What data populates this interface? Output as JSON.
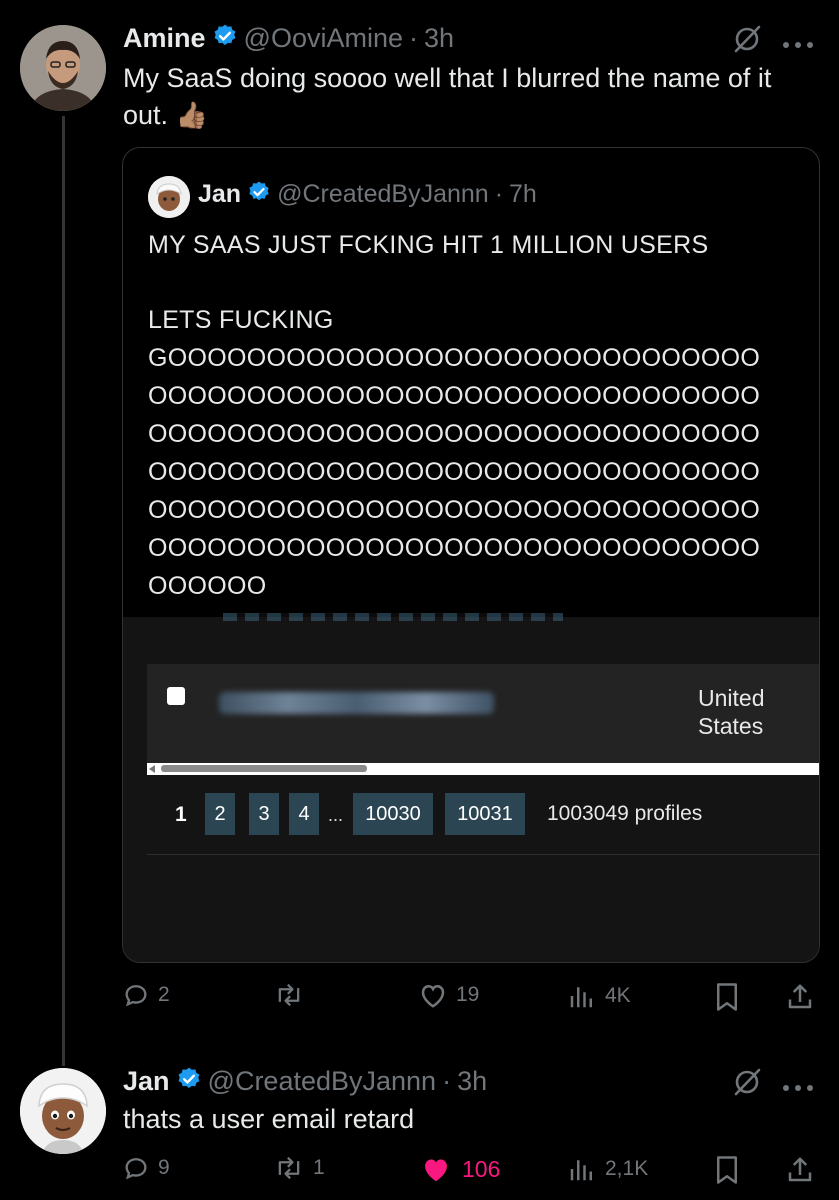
{
  "tweet": {
    "author_name": "Amine",
    "author_handle": "@OoviAmine",
    "separator": "·",
    "time": "3h",
    "text": "My SaaS doing soooo well that I blurred the name of it out.",
    "emoji": "👍🏽",
    "quote": {
      "author_name": "Jan",
      "author_handle": "@CreatedByJannn",
      "time": "7h",
      "line1": "MY SAAS JUST FCKING HIT 1 MILLION USERS",
      "line2": "LETS FUCKING",
      "go_text": "GOOOOOOOOOOOOOOOOOOOOOOOOOOOOOOOOOOOOOOOOOOOOOOOOOOOOOOOOOOOOOOOOOOOOOOOOOOOOOOOOOOOOOOOOOOOOOOOOOOOOOOOOOOOOOOOOOOOOOOOOOOOOOOOOOOOOOOOOOOOOOOOOOOOOOOOOOOOOOOOOOOOOOOOOOOOOOOOOOOOOOOOOOOOOOOO",
      "screenshot": {
        "country": "United\nStates",
        "pages": [
          "1",
          "2",
          "3",
          "4",
          "...",
          "10030",
          "10031"
        ],
        "profiles_text": "1003049 profiles"
      }
    },
    "actions": {
      "replies": "2",
      "reposts": "",
      "likes": "19",
      "views": "4K"
    }
  },
  "reply": {
    "author_name": "Jan",
    "author_handle": "@CreatedByJannn",
    "separator": "·",
    "time": "3h",
    "text": "thats a user email retard",
    "actions": {
      "replies": "9",
      "reposts": "1",
      "likes": "106",
      "views": "2,1K"
    }
  },
  "colors": {
    "background": "#000000",
    "verified": "#1d9bf0",
    "liked": "#f91880",
    "muted": "#71767b"
  }
}
